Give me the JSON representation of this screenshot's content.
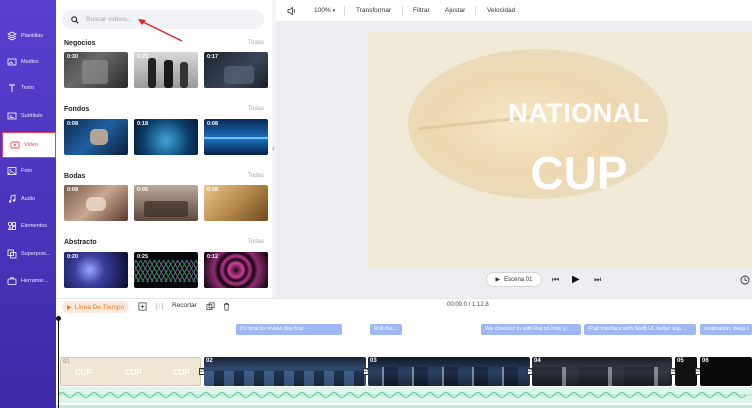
{
  "sidebar": {
    "items": [
      {
        "label": "Plantillas",
        "icon": "layers-icon"
      },
      {
        "label": "Medios",
        "icon": "media-icon"
      },
      {
        "label": "Texto",
        "icon": "text-icon"
      },
      {
        "label": "Subtítulo",
        "icon": "subtitle-icon"
      },
      {
        "label": "Video",
        "icon": "video-icon",
        "active": true
      },
      {
        "label": "Foto",
        "icon": "photo-icon"
      },
      {
        "label": "Audio",
        "icon": "audio-icon"
      },
      {
        "label": "Elementos",
        "icon": "elements-icon"
      },
      {
        "label": "Superposi...",
        "icon": "overlay-icon"
      },
      {
        "label": "Herramie...",
        "icon": "tools-icon"
      }
    ]
  },
  "search": {
    "placeholder": "Buscar videos..."
  },
  "sections": [
    {
      "title": "Negocios",
      "all": "Todas",
      "durations": [
        "0:30",
        "0:23",
        "0:17"
      ]
    },
    {
      "title": "Fondos",
      "all": "Todas",
      "durations": [
        "0:08",
        "0:18",
        "0:08"
      ]
    },
    {
      "title": "Bodas",
      "all": "Todas",
      "durations": [
        "0:08",
        "0:05",
        "0:08"
      ]
    },
    {
      "title": "Abstracto",
      "all": "Todas",
      "durations": [
        "0:20",
        "0:25",
        "0:12"
      ]
    }
  ],
  "toolbar": {
    "zoom": "100%",
    "transform": "Transformar",
    "filter": "Filtrar",
    "adjust": "Ajustar",
    "speed": "Velocidad"
  },
  "preview": {
    "line1": "NATIONAL",
    "line2": "CUP"
  },
  "player": {
    "scene": "Escena 01"
  },
  "timeline": {
    "tab": "Línea De Tiempo",
    "trim": "Recortar",
    "time": "00:00.0 / 1:12.8",
    "text_clips": [
      "It's time to review day four -",
      "Roll the...",
      "We checked in with Raj on how y...",
      "iPad interface with Swift UI, better sup...",
      "restoration, deep l"
    ],
    "scenes": [
      "01",
      "02",
      "03",
      "04",
      "05",
      "06"
    ],
    "scene01_texts": [
      "CUP",
      "CUP",
      "CUP"
    ]
  },
  "colors": {
    "accent": "#5a3fd0",
    "active": "#ef3b52",
    "clip": "#9fb7f5",
    "audio": "#6fd0a6"
  }
}
